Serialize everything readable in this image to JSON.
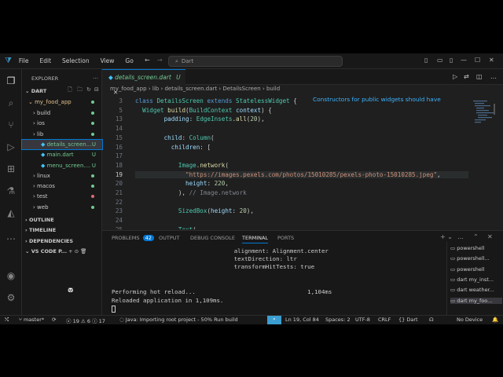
{
  "title_bar": {
    "menus": [
      "File",
      "Edit",
      "Selection",
      "View",
      "Go"
    ],
    "command_center": "Dart"
  },
  "sidebar": {
    "header": "EXPLORER",
    "root": "DART",
    "project": "my_food_app",
    "items": [
      {
        "label": "build",
        "indent": 1,
        "folder": true
      },
      {
        "label": "ios",
        "indent": 1,
        "folder": true
      },
      {
        "label": "lib",
        "indent": 1,
        "folder": true
      },
      {
        "label": "details_screen...",
        "indent": 2,
        "badge": "U",
        "selected": true
      },
      {
        "label": "main.dart",
        "indent": 2,
        "badge": "U"
      },
      {
        "label": "menu_screen....",
        "indent": 2,
        "badge": "U"
      },
      {
        "label": "linux",
        "indent": 1,
        "folder": true
      },
      {
        "label": "macos",
        "indent": 1,
        "folder": true
      },
      {
        "label": "test",
        "indent": 1,
        "folder": true
      },
      {
        "label": "web",
        "indent": 1,
        "folder": true
      }
    ],
    "sections": [
      "OUTLINE",
      "TIMELINE",
      "DEPENDENCIES",
      "VS CODE P..."
    ]
  },
  "editor": {
    "tab_label": "details_screen.dart",
    "tab_status": "U",
    "breadcrumb": [
      "my_food_app",
      "lib",
      "details_screen.dart",
      "DetailsScreen",
      "build"
    ],
    "hint": "Constructors for public widgets should have",
    "lines": [
      {
        "n": "3",
        "html": "<span class='kw'>class</span> <span class='ty'>DetailsScreen</span> <span class='kw'>extends</span> <span class='ty'>StatelessWidget</span> {"
      },
      {
        "n": "5",
        "html": "  <span class='ty'>Widget</span> <span class='fn'>build</span>(<span class='ty'>BuildContext</span> <span class='pa'>context</span>) {"
      },
      {
        "n": "13",
        "html": "        <span class='pa'>padding</span>: <span class='ty'>EdgeInsets</span>.<span class='fn'>all</span>(<span class='nu'>20</span>),"
      },
      {
        "n": "14",
        "html": ""
      },
      {
        "n": "15",
        "html": "        <span class='pa'>child</span>: <span class='ty'>Column</span>("
      },
      {
        "n": "16",
        "html": "          <span class='pa'>children</span>: ["
      },
      {
        "n": "17",
        "html": ""
      },
      {
        "n": "18",
        "html": "            <span class='ty'>Image</span>.<span class='fn'>network</span>("
      },
      {
        "n": "19",
        "html": "              <span class='st'>\"https://images.pexels.com/photos/15010285/pexels-photo-15010285.jpeg\"</span>,",
        "cur": true
      },
      {
        "n": "20",
        "html": "              <span class='pa'>height</span>: <span class='nu'>220</span>,"
      },
      {
        "n": "21",
        "html": "            ), <span class='cm'>// Image.network</span>"
      },
      {
        "n": "22",
        "html": ""
      },
      {
        "n": "23",
        "html": "            <span class='ty'>SizedBox</span>(<span class='pa'>height</span>: <span class='nu'>20</span>),"
      },
      {
        "n": "24",
        "html": ""
      },
      {
        "n": "25",
        "html": "            <span class='ty'>Text</span>("
      }
    ]
  },
  "panel": {
    "tabs": [
      "PROBLEMS",
      "OUTPUT",
      "DEBUG CONSOLE",
      "TERMINAL",
      "PORTS"
    ],
    "problems_count": "42",
    "terminal_lines": [
      {
        "t": "                                   alignment: Alignment.center",
        "y": 0
      },
      {
        "t": "                                   textDirection: ltr",
        "y": 10
      },
      {
        "t": "                                   transformHitTests: true",
        "y": 20
      },
      {
        "t": "Performing hot reload...                                1,104ms",
        "y": 52
      },
      {
        "t": "Reloaded application in 1,109ms.",
        "y": 63
      }
    ],
    "terminal_list": [
      "powershell",
      "powershell...",
      "powershell",
      "dart  my_inst...",
      "dart  weather...",
      "dart  my_foo..."
    ]
  },
  "status_bar": {
    "branch": "master*",
    "errors": "19",
    "warnings": "6",
    "info": "17",
    "java": "Java: Importing root project - 50% Run build",
    "position": "Ln 19, Col 84",
    "spaces": "Spaces: 2",
    "encoding": "UTF-8",
    "eol": "CRLF",
    "language": "Dart",
    "device": "No Device"
  }
}
